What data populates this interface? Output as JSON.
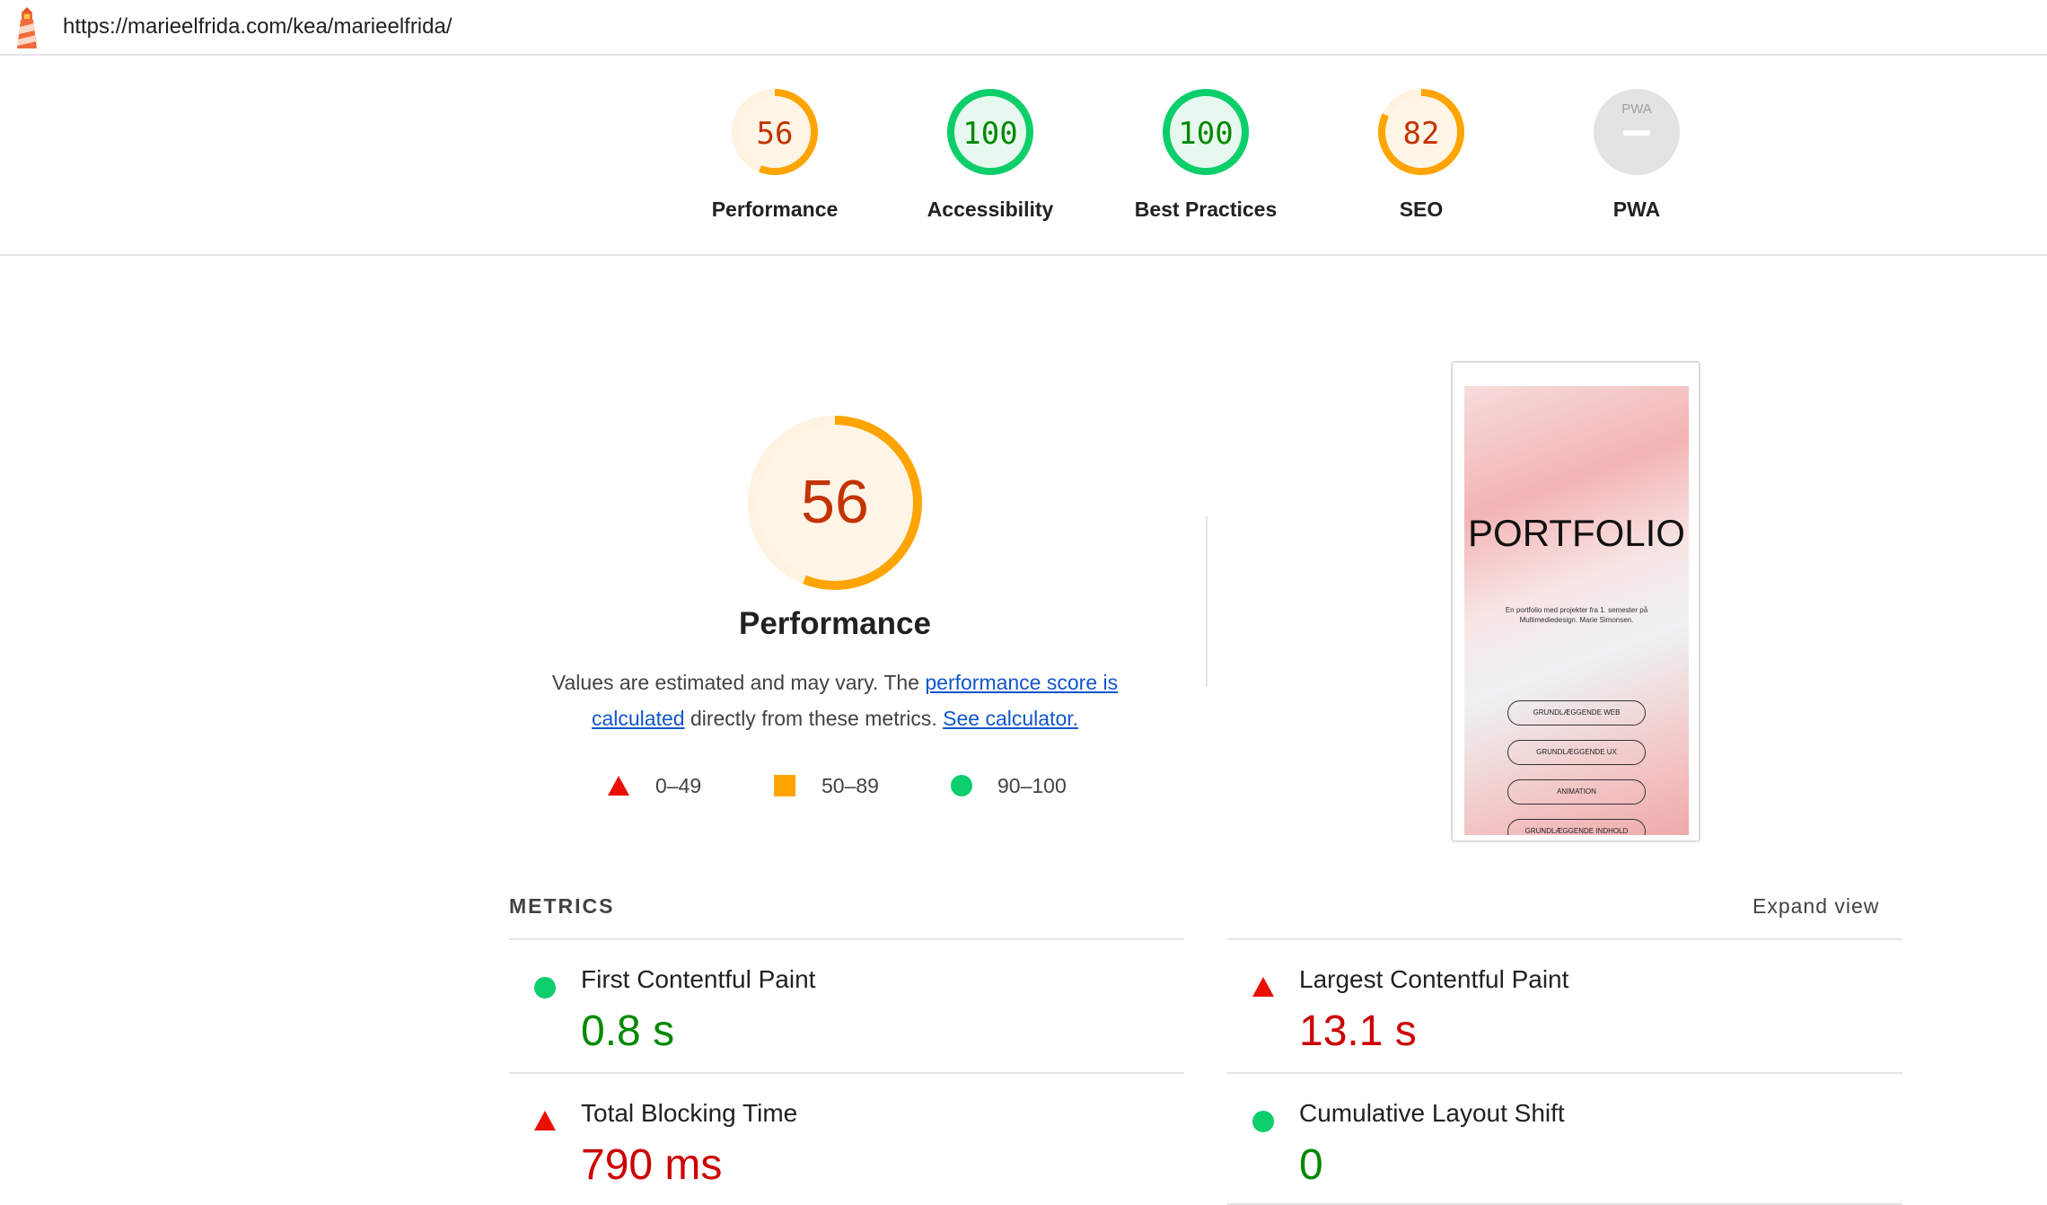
{
  "url": "https://marieelfrida.com/kea/marieelfrida/",
  "gauges": [
    {
      "label": "Performance",
      "score": "56",
      "fraction": 0.56,
      "status": "average"
    },
    {
      "label": "Accessibility",
      "score": "100",
      "fraction": 1.0,
      "status": "pass"
    },
    {
      "label": "Best Practices",
      "score": "100",
      "fraction": 1.0,
      "status": "pass"
    },
    {
      "label": "SEO",
      "score": "82",
      "fraction": 0.82,
      "status": "average"
    },
    {
      "label": "PWA",
      "score": "",
      "fraction": 0,
      "status": "na",
      "badge_text": "PWA"
    }
  ],
  "performance": {
    "score": "56",
    "fraction": 0.56,
    "title": "Performance",
    "desc_prefix": "Values are estimated and may vary. The ",
    "desc_link1": "performance score is calculated",
    "desc_middle": " directly from these metrics. ",
    "desc_link2": "See calculator."
  },
  "legend": [
    {
      "shape": "triangle",
      "range": "0–49"
    },
    {
      "shape": "square",
      "range": "50–89"
    },
    {
      "shape": "circle",
      "range": "90–100"
    }
  ],
  "screenshot": {
    "title": "PORTFOLIO",
    "subtitle": "En portfolio med projekter fra 1. semester på Multimediedesign. Marie Simonsen.",
    "buttons": [
      "GRUNDLÆGGENDE WEB",
      "GRUNDLÆGGENDE UX",
      "ANIMATION",
      "GRUNDLÆGGENDE INDHOLD"
    ]
  },
  "metrics_section": {
    "header": "METRICS",
    "expand_label": "Expand view",
    "items": [
      {
        "title": "First Contentful Paint",
        "value": "0.8 s",
        "status": "pass"
      },
      {
        "title": "Largest Contentful Paint",
        "value": "13.1 s",
        "status": "fail"
      },
      {
        "title": "Total Blocking Time",
        "value": "790 ms",
        "status": "fail"
      },
      {
        "title": "Cumulative Layout Shift",
        "value": "0",
        "status": "pass"
      }
    ]
  },
  "colors": {
    "pass": "#0cce6b",
    "pass_text": "#008800",
    "average": "#ffa400",
    "average_text": "#c33300",
    "fail": "#ff4e42",
    "fail_text": "#cc0000",
    "link": "#1155cc"
  }
}
